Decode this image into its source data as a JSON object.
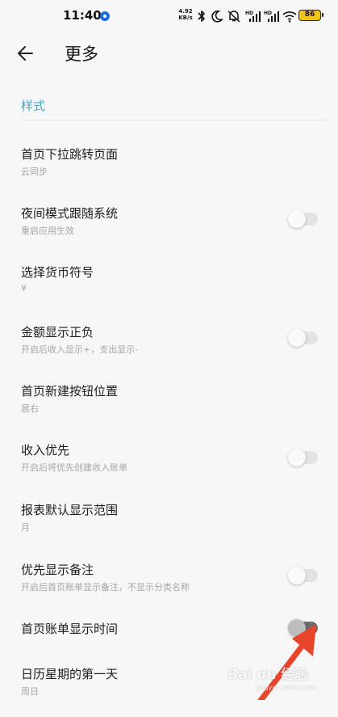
{
  "status_bar": {
    "time": "11:40",
    "net_speed_value": "4.92",
    "net_speed_unit": "KB/s",
    "battery": "86",
    "icons": [
      "notification-dot-icon",
      "bluetooth-icon",
      "moon-icon",
      "mute-bell-icon",
      "signal-icon",
      "signal-icon",
      "wifi-icon",
      "battery-icon"
    ]
  },
  "header": {
    "title": "更多",
    "back_icon": "arrow-left-icon"
  },
  "section": {
    "title": "样式"
  },
  "settings": [
    {
      "title": "首页下拉跳转页面",
      "subtitle": "云同步",
      "has_toggle": false
    },
    {
      "title": "夜间模式跟随系统",
      "subtitle": "重启应用生效",
      "has_toggle": true,
      "toggle_on": false
    },
    {
      "title": "选择货币符号",
      "subtitle": "¥",
      "has_toggle": false
    },
    {
      "title": "金额显示正负",
      "subtitle": "开启后收入显示+，支出显示-",
      "has_toggle": true,
      "toggle_on": false
    },
    {
      "title": "首页新建按钮位置",
      "subtitle": "居右",
      "has_toggle": false
    },
    {
      "title": "收入优先",
      "subtitle": "开启后将优先创建收入账单",
      "has_toggle": true,
      "toggle_on": false
    },
    {
      "title": "报表默认显示范围",
      "subtitle": "月",
      "has_toggle": false
    },
    {
      "title": "优先显示备注",
      "subtitle": "开启后首页账单显示备注，不显示分类名称",
      "has_toggle": true,
      "toggle_on": false
    },
    {
      "title": "首页账单显示时间",
      "subtitle": "",
      "has_toggle": true,
      "toggle_on": false
    },
    {
      "title": "日历星期的第一天",
      "subtitle": "周日",
      "has_toggle": false
    }
  ],
  "overlay": {
    "arrow_color": "#e8442a",
    "watermark": "Bai du 经验",
    "watermark_sub": "jingyan.baidu.com"
  },
  "colors": {
    "accent": "#3fa9c9",
    "background": "#f7f7f7"
  }
}
